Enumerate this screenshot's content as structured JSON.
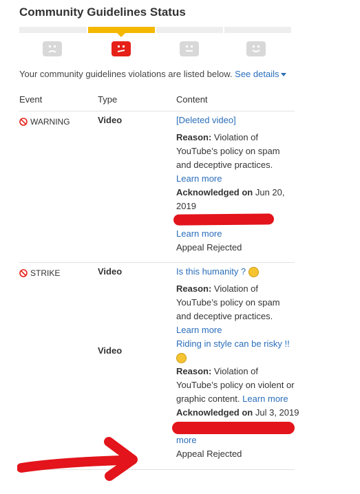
{
  "header": {
    "title": "Community Guidelines Status"
  },
  "summary": {
    "text": "Your community guidelines violations are listed below.",
    "see_details": "See details"
  },
  "columns": {
    "event": "Event",
    "type": "Type",
    "content": "Content"
  },
  "rows": [
    {
      "event": "WARNING",
      "type": "Video",
      "video_title": "[Deleted video]",
      "reason_label": "Reason:",
      "reason_lines": [
        "Violation of",
        "YouTube’s policy on spam",
        "and deceptive practices."
      ],
      "learn_more": "Learn more",
      "ack_label": "Acknowledged on",
      "ack_date_1": "Jun 20,",
      "ack_date_2": "2019",
      "learn_more_2": "Learn more",
      "status": "Appeal Rejected"
    },
    {
      "event": "STRIKE",
      "type_1": "Video",
      "video_title_1": "Is this humanity ?",
      "reason_label_1": "Reason:",
      "reason_lines_1": [
        "Violation of",
        "YouTube’s policy on spam",
        "and deceptive practices."
      ],
      "learn_more_1": "Learn more",
      "type_2": "Video",
      "video_title_2": "Riding in style can be risky !!",
      "reason_label_2": "Reason:",
      "reason_lines_2": [
        "Violation of",
        "YouTube’s policy on violent or",
        "graphic content."
      ],
      "learn_more_2": "Learn more",
      "ack_label": "Acknowledged on",
      "ack_date": "Jul 3, 2019",
      "more": "more",
      "status": "Appeal Rejected"
    }
  ],
  "colors": {
    "accent": "#f4b800",
    "link": "#2a6ebb",
    "alert": "#e62117",
    "annotation": "#e3141b"
  }
}
